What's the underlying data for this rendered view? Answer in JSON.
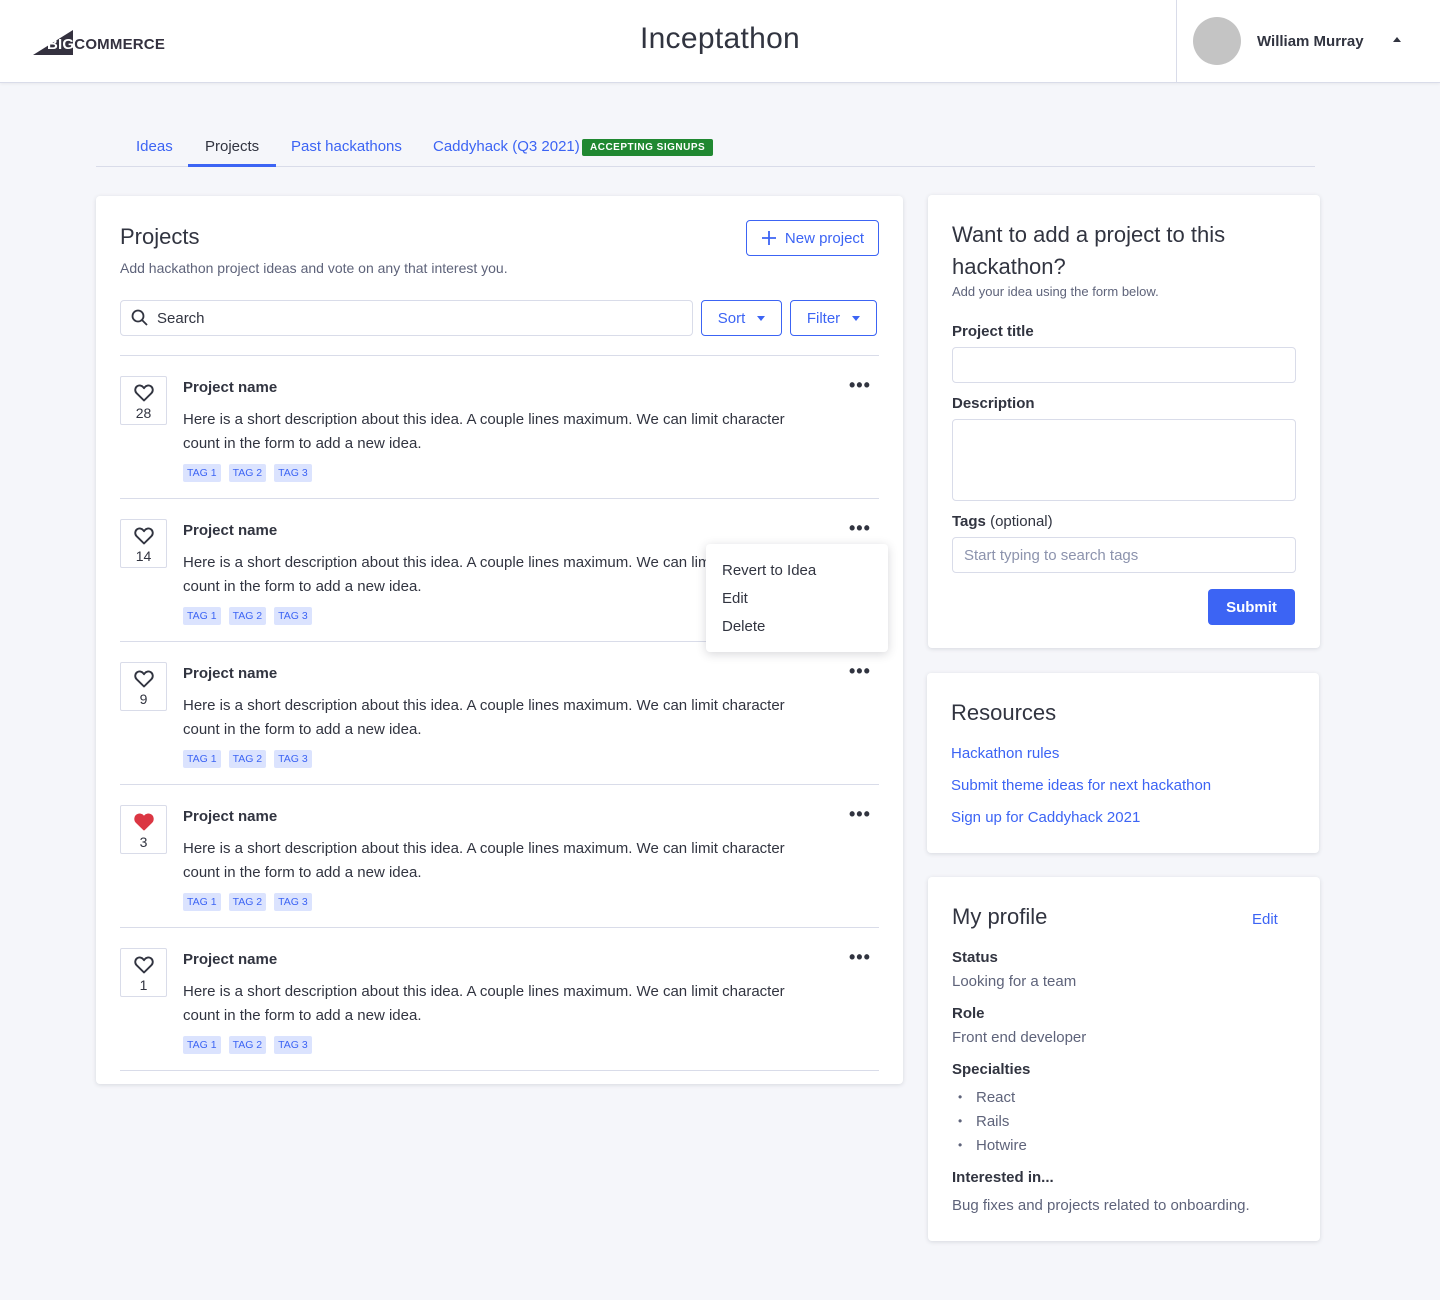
{
  "header": {
    "logo_text_big": "BIG",
    "logo_text_commerce": "COMMERCE",
    "title": "Inceptathon",
    "user_name": "William Murray"
  },
  "tabs": [
    {
      "label": "Ideas"
    },
    {
      "label": "Projects"
    },
    {
      "label": "Past hackathons"
    },
    {
      "label": "Caddyhack (Q3 2021)"
    }
  ],
  "tabs_badge": "ACCEPTING SIGNUPS",
  "projects": {
    "title": "Projects",
    "subtitle": "Add hackathon project ideas and vote on any that interest you.",
    "new_button": "New project",
    "search_placeholder": "Search",
    "sort_label": "Sort",
    "filter_label": "Filter",
    "items": [
      {
        "votes": "28",
        "liked": false,
        "name": "Project name",
        "description": "Here is a short description about this idea. A couple lines maximum. We can limit character count in the form to add a new idea.",
        "tags": [
          "TAG 1",
          "TAG 2",
          "TAG 3"
        ]
      },
      {
        "votes": "14",
        "liked": false,
        "name": "Project name",
        "description": "Here is a short description about this idea. A couple lines maximum. We can limit character count in the form to add a new idea.",
        "tags": [
          "TAG 1",
          "TAG 2",
          "TAG 3"
        ]
      },
      {
        "votes": "9",
        "liked": false,
        "name": "Project name",
        "description": "Here is a short description about this idea. A couple lines maximum. We can limit character count in the form to add a new idea.",
        "tags": [
          "TAG 1",
          "TAG 2",
          "TAG 3"
        ]
      },
      {
        "votes": "3",
        "liked": true,
        "name": "Project name",
        "description": "Here is a short description about this idea. A couple lines maximum. We can limit character count in the form to add a new idea.",
        "tags": [
          "TAG 1",
          "TAG 2",
          "TAG 3"
        ]
      },
      {
        "votes": "1",
        "liked": false,
        "name": "Project name",
        "description": "Here is a short description about this idea. A couple lines maximum. We can limit character count in the form to add a new idea.",
        "tags": [
          "TAG 1",
          "TAG 2",
          "TAG 3"
        ]
      }
    ],
    "menu": [
      "Revert to Idea",
      "Edit",
      "Delete"
    ]
  },
  "add_form": {
    "title": "Want to add a project to this hackathon?",
    "subtitle": "Add your idea using the form below.",
    "project_title_label": "Project title",
    "project_title_value": "",
    "description_label": "Description",
    "description_value": "",
    "tags_label": "Tags",
    "tags_optional": "(optional)",
    "tags_placeholder": "Start typing to search tags",
    "submit_label": "Submit"
  },
  "resources": {
    "title": "Resources",
    "links": [
      "Hackathon rules",
      "Submit theme ideas for next hackathon",
      "Sign up for Caddyhack 2021"
    ]
  },
  "profile": {
    "title": "My profile",
    "edit_label": "Edit",
    "status_label": "Status",
    "status_value": "Looking for a team",
    "role_label": "Role",
    "role_value": "Front end developer",
    "specialties_label": "Specialties",
    "specialties": [
      "React",
      "Rails",
      "Hotwire"
    ],
    "interested_label": "Interested in...",
    "interested_value": "Bug fixes and projects related to onboarding."
  },
  "colors": {
    "primary": "#3c64f4",
    "badge_green": "#208831",
    "liked_heart": "#db3643",
    "tag_bg": "#dbe3fe"
  }
}
